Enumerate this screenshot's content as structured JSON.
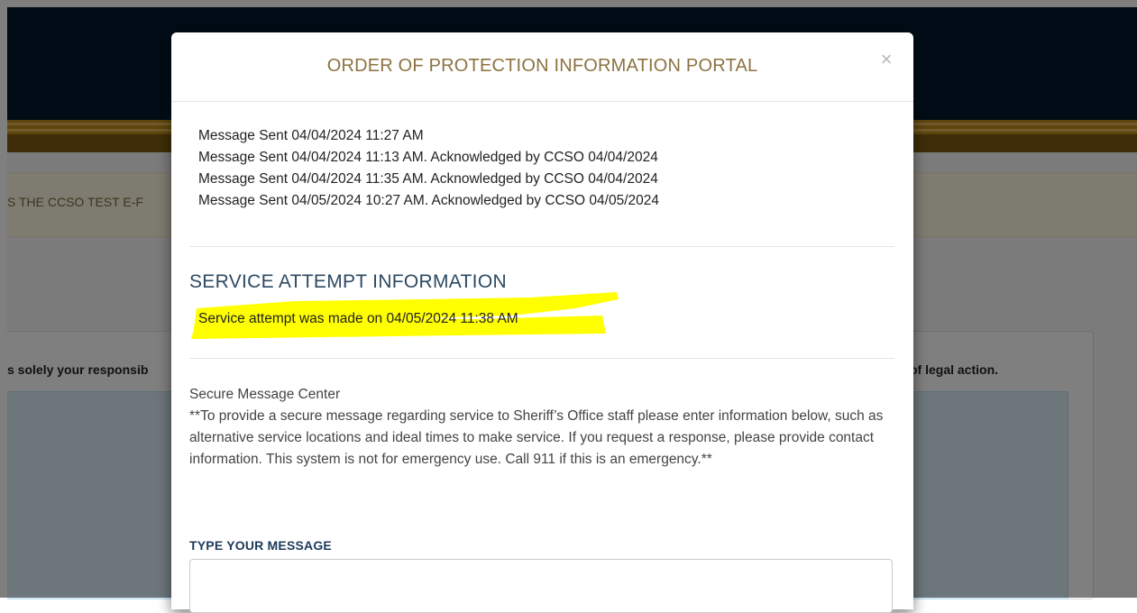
{
  "background": {
    "alert_text": "S THE CCSO TEST E-F",
    "panel_text_left": "s solely your responsib",
    "panel_text_right": "of legal action."
  },
  "modal": {
    "title": "ORDER OF PROTECTION INFORMATION PORTAL",
    "close_label": "×",
    "messages": [
      "Message Sent 04/04/2024 11:27 AM",
      "Message Sent 04/04/2024 11:13 AM. Acknowledged by CCSO 04/04/2024",
      "Message Sent 04/04/2024 11:35 AM. Acknowledged by CCSO 04/04/2024",
      "Message Sent 04/05/2024 10:27 AM. Acknowledged by CCSO 04/05/2024"
    ],
    "service_heading": "SERVICE ATTEMPT INFORMATION",
    "service_attempt": "Service attempt was made on 04/05/2024 11:38 AM",
    "secure_title": "Secure Message Center",
    "secure_body": "**To provide a secure message regarding service to Sheriff’s Office staff please enter information below, such as alternative service locations and ideal times to make service. If you request a response, please provide contact information. This system is not for emergency use. Call 911 if this is an emergency.**",
    "type_label": "TYPE YOUR MESSAGE",
    "message_value": ""
  },
  "colors": {
    "navbar": "#03182c",
    "gold": "#be8a1d",
    "modal_title": "#8c7341",
    "highlight": "#ffff00"
  },
  "icons": {
    "close": "close-icon"
  }
}
